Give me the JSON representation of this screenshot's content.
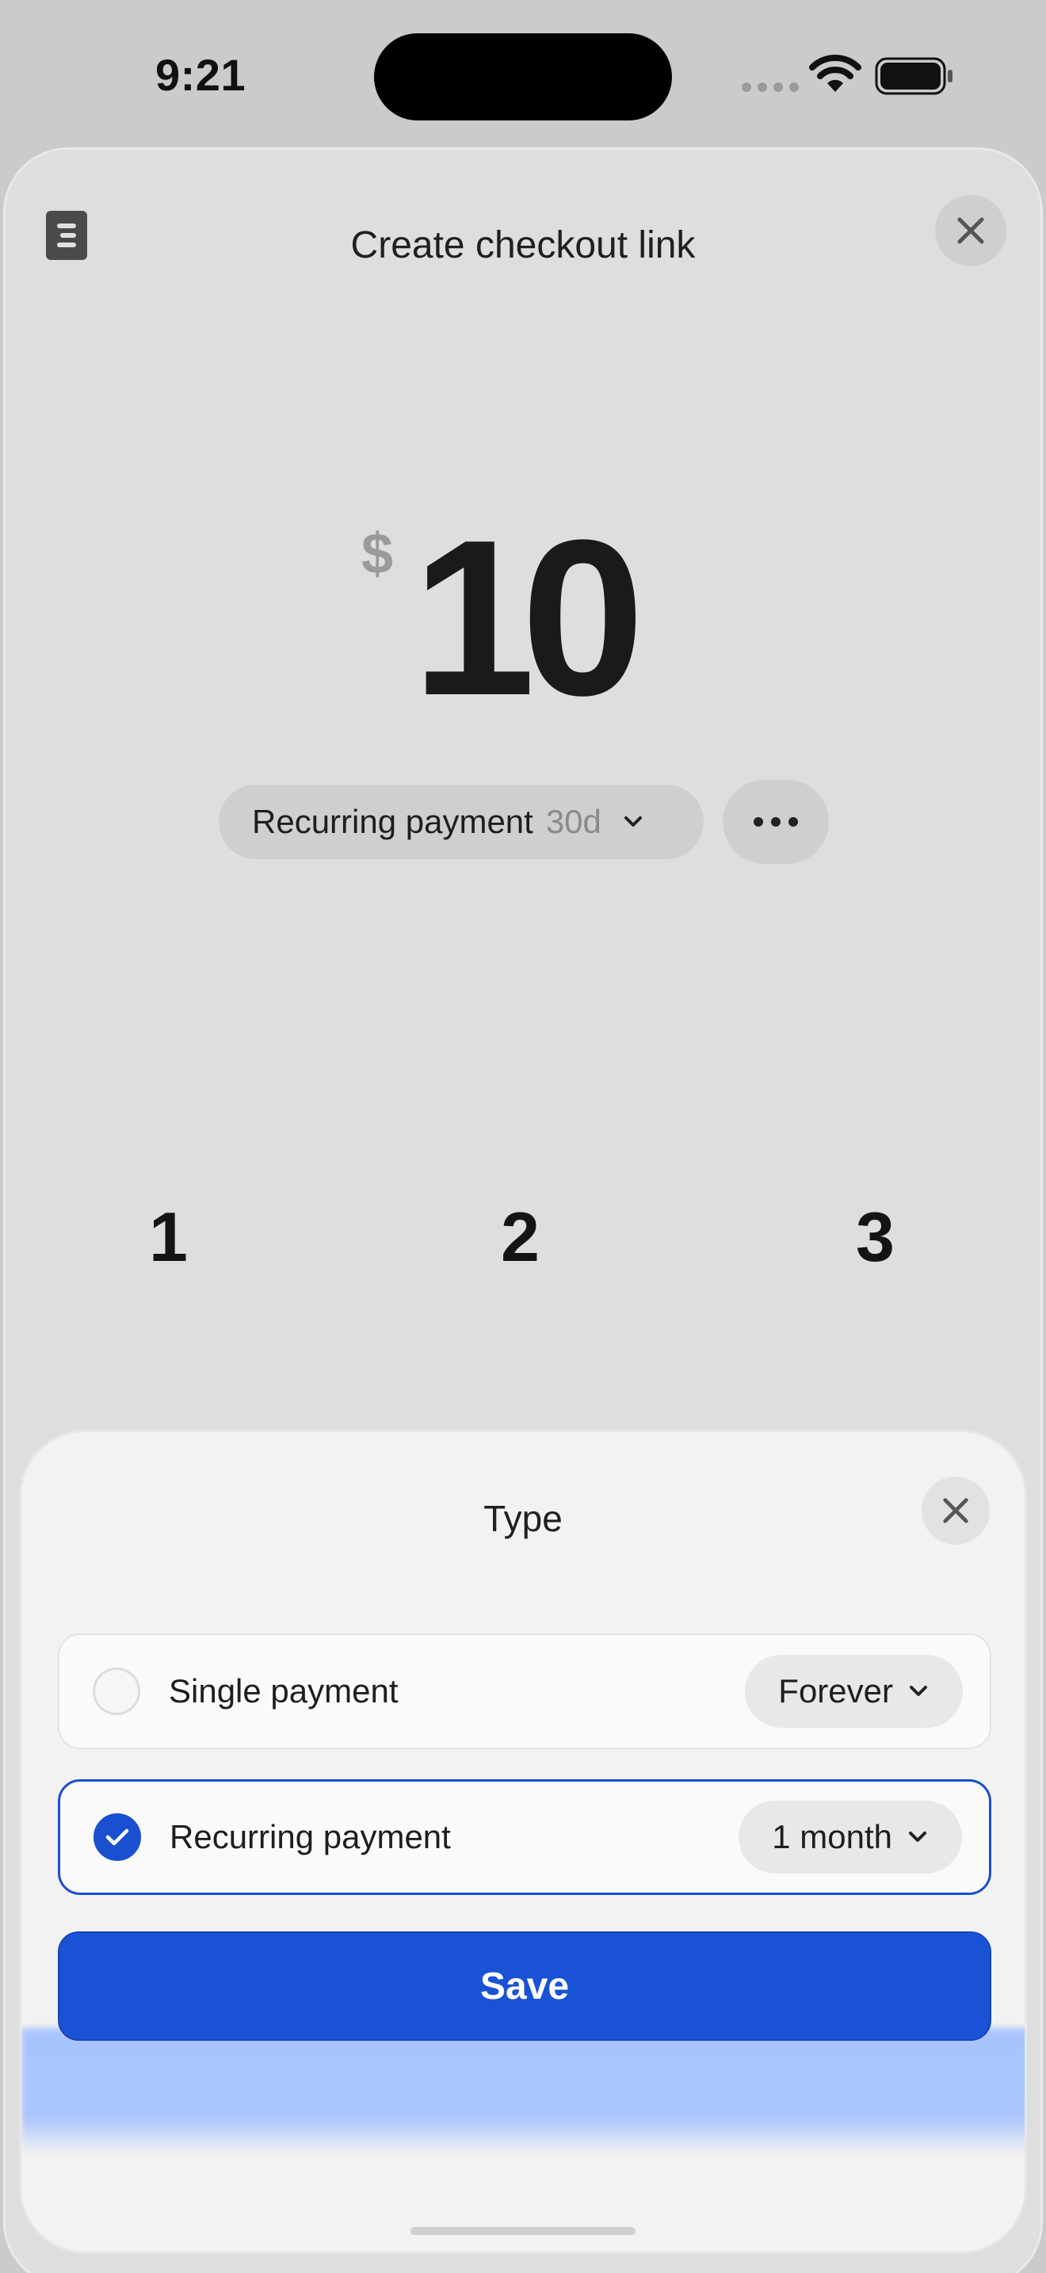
{
  "status_bar": {
    "time": "9:21"
  },
  "sheet": {
    "title": "Create checkout link",
    "currency_symbol": "$",
    "amount": "10",
    "type_pill": {
      "label": "Recurring payment",
      "sub": "30d"
    },
    "keypad": [
      "1",
      "2",
      "3"
    ]
  },
  "modal": {
    "title": "Type",
    "options": [
      {
        "label": "Single payment",
        "duration": "Forever",
        "selected": false
      },
      {
        "label": "Recurring payment",
        "duration": "1 month",
        "selected": true
      }
    ],
    "save_label": "Save"
  },
  "colors": {
    "accent": "#1A52D6",
    "sheet_bg": "#DEDEDE",
    "modal_bg": "#F2F2F2"
  }
}
